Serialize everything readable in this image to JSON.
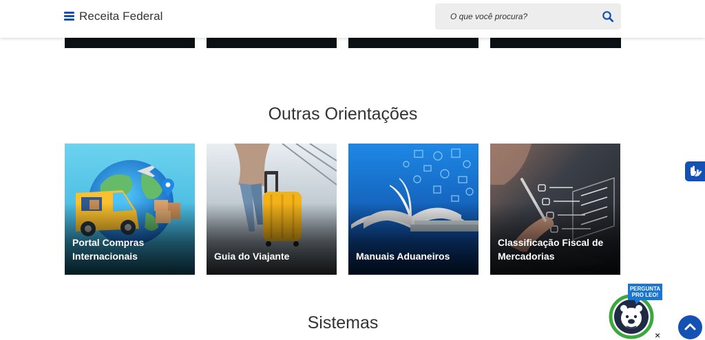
{
  "header": {
    "menu_icon": "hamburger-menu-icon",
    "brand": "Receita Federal",
    "search": {
      "placeholder": "O que você procura?",
      "icon": "search-icon"
    }
  },
  "sections": {
    "outras_orientacoes": {
      "title": "Outras Orientações",
      "cards": [
        {
          "label": "Portal Compras Internacionais"
        },
        {
          "label": "Guia do Viajante"
        },
        {
          "label": "Manuais Aduaneiros"
        },
        {
          "label": "Classificação Fiscal de Mercadorias"
        }
      ]
    },
    "sistemas": {
      "title": "Sistemas"
    }
  },
  "widgets": {
    "accessibility": {
      "icon": "sign-language-hands-icon"
    },
    "leo": {
      "badge_line1": "PERGUNTA",
      "badge_line2": "PRO LEO!",
      "close": "×"
    },
    "back_to_top": {
      "icon": "chevron-up-icon"
    }
  },
  "colors": {
    "primary": "#1351b4",
    "text": "#333333",
    "search_bg": "#ededed",
    "leo_green": "#3aa83a"
  }
}
